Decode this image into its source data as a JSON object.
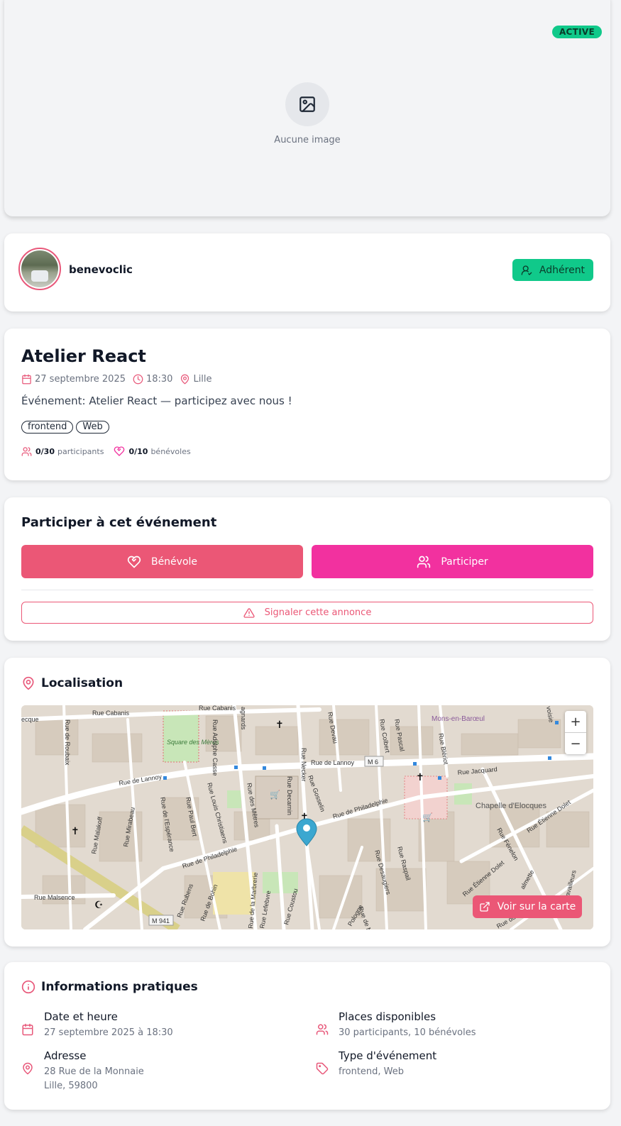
{
  "hero": {
    "status_badge": "ACTIVE",
    "no_image_text": "Aucune image"
  },
  "organizer": {
    "name": "benevoclic",
    "member_label": "Adhérent"
  },
  "event": {
    "title": "Atelier React",
    "date": "27 septembre 2025",
    "time": "18:30",
    "city": "Lille",
    "description": "Événement: Atelier React — participez avec nous !",
    "tags": [
      "frontend",
      "Web"
    ],
    "participants_count": "0/30",
    "participants_label": "participants",
    "volunteers_count": "0/10",
    "volunteers_label": "bénévoles"
  },
  "participate": {
    "title": "Participer à cet événement",
    "volunteer_button": "Bénévole",
    "participate_button": "Participer",
    "report_button": "Signaler cette annonce"
  },
  "location": {
    "title": "Localisation",
    "view_map_button": "Voir sur la carte",
    "zoom_in": "+",
    "zoom_out": "−",
    "map_labels": {
      "rue_cabanis_1": "Rue Cabanis",
      "rue_cabanis_2": "Rue Cabanis",
      "ecque": "ecque",
      "square": "Square des Mères",
      "rue_de_lannoy_1": "Rue de Lannoy",
      "rue_de_lannoy_2": "Rue de Lannoy",
      "m6": "M 6",
      "rue_jacquard": "Rue Jacquard",
      "mons": "Mons-en-Barœul",
      "chapelle": "Chapelle d'Elocques",
      "rue_de_philadelphie_1": "Rue de Philadelphie",
      "rue_de_philadelphie_2": "Rue de Philadelphie",
      "rue_malsence": "Rue Malsence",
      "m941": "M 941",
      "rue_necker": "Rue Necker",
      "rue_devau": "Rue Devau",
      "rue_colbert": "Rue Colbert",
      "rue_pascal": "Rue Pascal",
      "rue_bleriot": "Rue Blériot",
      "rue_adolphe_casse": "Rue Adolphe Casse",
      "rue_decarnin": "Rue Decarnin",
      "rue_gosselin": "Rue Gosselin",
      "rue_des_meteres": "Rue des Mêtres",
      "rue_louis_christiaens": "Rue Louis Christiaens",
      "rue_paul_bert": "Rue Paul Bert",
      "rue_esperance": "Rue de l'Espérance",
      "rue_mirabeau": "Rue Mirabeau",
      "rue_malakoff": "Rue Malakoff",
      "rue_desaugiers": "Rue Desaugiers",
      "rue_raspail": "Rue Raspail",
      "rue_etienne_dolet_1": "Rue Étienne Dolet",
      "rue_etienne_dolet_2": "Rue Étienne Dolet",
      "rue_fenelon": "Rue Fénelon",
      "rue_rubens": "Rue Rubens",
      "rue_de_bohin": "Rue de Bohin",
      "rue_marbrerie": "Rue de la Marbrerie",
      "rue_coustou": "Rue Coustou",
      "rue_lefebvre": "Rue Lefebvre",
      "pologne": "Pologne",
      "rue_de_ma": "Rue de Ma",
      "palmette": "almette",
      "travailleurs": "availleurs",
      "rue_du": "Rue du",
      "rue_de_roubaix": "Rue de Roubaix",
      "rue_gagnards": "agnards",
      "voisie": "voisie"
    }
  },
  "info": {
    "title": "Informations pratiques",
    "date_title": "Date et heure",
    "date_value": "27 septembre 2025 à 18:30",
    "places_title": "Places disponibles",
    "places_value": "30 participants, 10 bénévoles",
    "address_title": "Adresse",
    "address_line1": "28 Rue de la Monnaie",
    "address_line2": "Lille, 59800",
    "type_title": "Type d'événement",
    "type_value": "frontend, Web"
  }
}
